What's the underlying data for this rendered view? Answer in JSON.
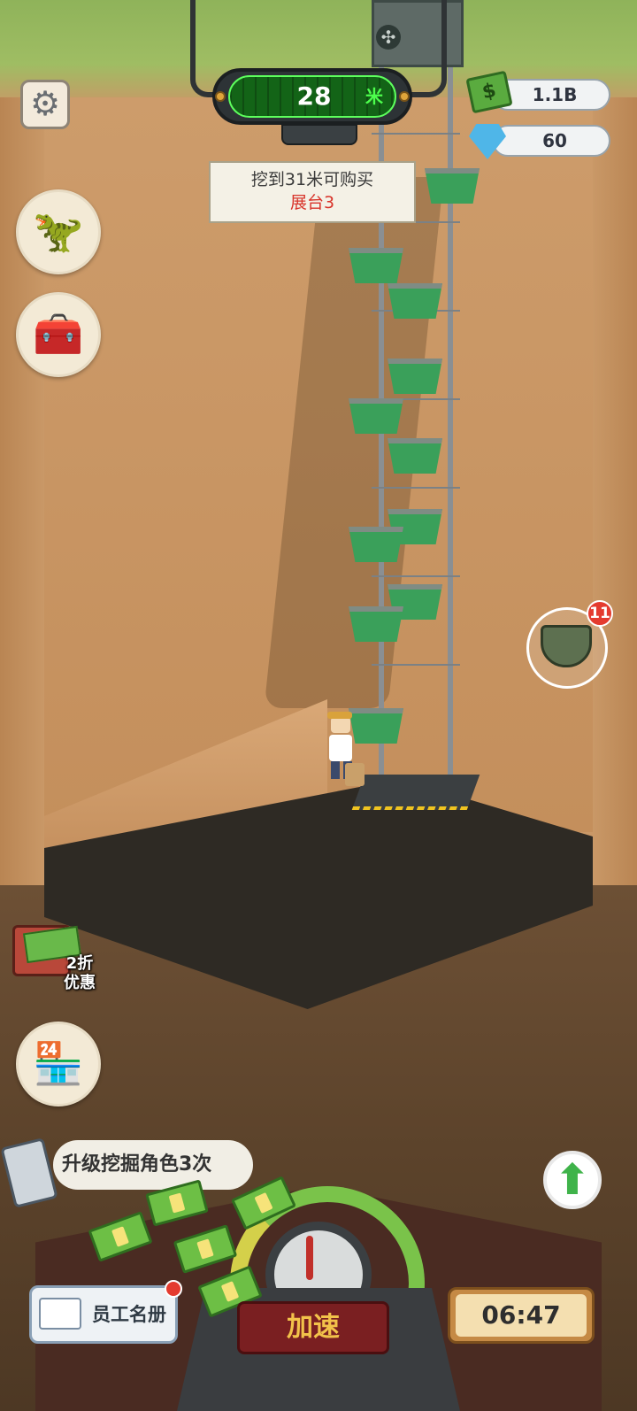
{
  "depth_meter": {
    "value": "28",
    "unit": "米"
  },
  "notice": {
    "line1": "挖到31米可购买",
    "line2": "展台3"
  },
  "currencies": {
    "cash": "1.1B",
    "gems": "60"
  },
  "icons": {
    "settings": "gear-icon",
    "fossil": "dinosaur-skull-icon",
    "treasure": "treasure-chest-icon",
    "shop": "shop-storefront-icon",
    "artifact": "bronze-pot-icon",
    "upgrade": "up-arrow-icon"
  },
  "artifact_badge": "11",
  "discount": {
    "label_line1": "2折",
    "label_line2": "优惠"
  },
  "task": {
    "text": "升级挖掘角色3次"
  },
  "speed_button": "加速",
  "staff_button": "员工名册",
  "timer": "06:47",
  "shop_sign": "SHOP",
  "colors": {
    "accent_green": "#3fb34a",
    "alert_red": "#e43b2f",
    "depth_green": "#4dff4d"
  }
}
